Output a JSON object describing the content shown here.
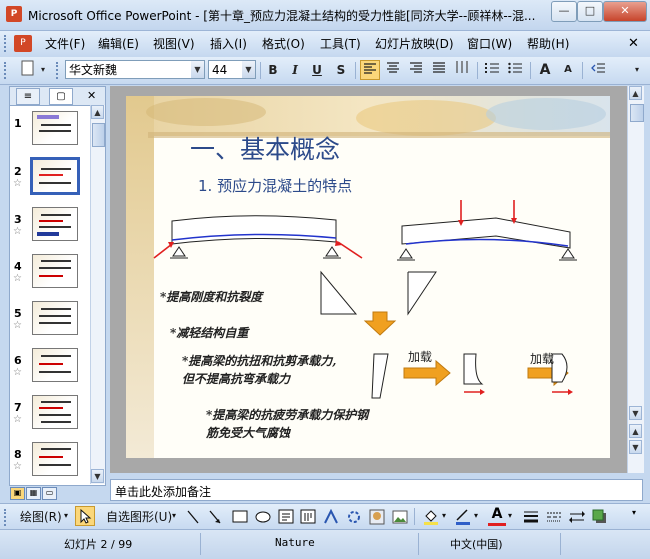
{
  "window": {
    "app_icon": "P",
    "title": "Microsoft Office PowerPoint - [第十章_预应力混凝土结构的受力性能[同济大学--顾祥林--混...",
    "min_glyph": "—",
    "max_glyph": "□",
    "close_glyph": "✕",
    "doc_close_glyph": "✕"
  },
  "menu": {
    "items": [
      "文件(F)",
      "编辑(E)",
      "视图(V)",
      "插入(I)",
      "格式(O)",
      "工具(T)",
      "幻灯片放映(D)",
      "窗口(W)",
      "帮助(H)"
    ]
  },
  "toolbar": {
    "font_name": "华文新魏",
    "font_size": "44",
    "bold": "B",
    "italic": "I",
    "underline": "U",
    "shadow": "S",
    "grow_font": "A",
    "shrink_font": "A"
  },
  "panel": {
    "tab_outline": "≡",
    "tab_slides": "▢",
    "close": "✕",
    "slides": [
      "1",
      "2",
      "3",
      "4",
      "5",
      "6",
      "7",
      "8"
    ],
    "star": "☆"
  },
  "slide": {
    "title": "一、基本概念",
    "subtitle": "1. 预应力混凝土的特点",
    "text1": "*提高刚度和抗裂度",
    "text2": "*减轻结构自重",
    "text3a": "*提高梁的抗扭和抗剪承载力,",
    "text3b": "但不提高抗弯承载力",
    "text4a": "*提高梁的抗疲劳承载力保护钢",
    "text4b": "筋免受大气腐蚀",
    "label_load1": "加载",
    "label_load2": "加载"
  },
  "notes": {
    "placeholder": "单击此处添加备注"
  },
  "drawbar": {
    "draw": "绘图(R)",
    "autoshapes": "自选图形(U)"
  },
  "status": {
    "slide_count": "幻灯片 2 / 99",
    "theme": "Nature",
    "language": "中文(中国)"
  },
  "colors": {
    "accent": "#3560b8",
    "arrow_red": "#e02020",
    "arrow_orange": "#f0a020",
    "title_blue": "#2c4a8a"
  }
}
